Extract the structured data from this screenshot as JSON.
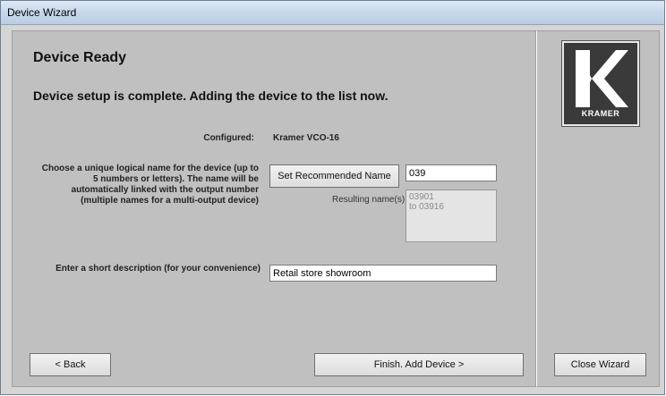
{
  "window": {
    "title": "Device Wizard"
  },
  "main": {
    "heading": "Device Ready",
    "subheading": "Device setup is complete. Adding the device to the list now.",
    "configured_label": "Configured:",
    "configured_value": "Kramer VCO-16",
    "instruction": "Choose a unique logical name for the device (up to 5 numbers or letters). The name will be automatically linked with the output number (multiple names for a multi-output device)",
    "set_name_button": "Set Recommended Name",
    "name_value": "039",
    "resulting_label": "Resulting name(s):",
    "resulting_lines": [
      "03901",
      "to 03916"
    ],
    "description_label": "Enter a short description (for your convenience)",
    "description_value": "Retail store showroom"
  },
  "footer": {
    "back_button": "< Back",
    "finish_button": "Finish. Add Device >",
    "close_button": "Close Wizard"
  },
  "logo": {
    "text": "KRAMER"
  }
}
